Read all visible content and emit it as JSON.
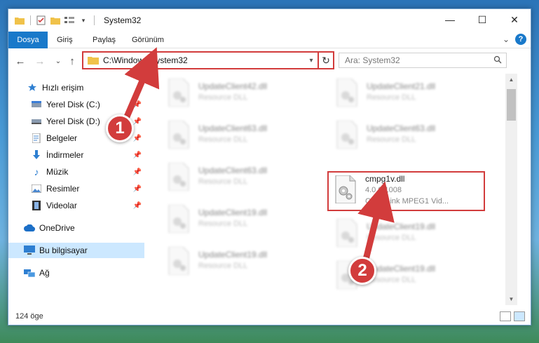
{
  "window": {
    "title": "System32",
    "controls": {
      "minimize": "—",
      "maximize": "☐",
      "close": "✕"
    }
  },
  "ribbon": {
    "tabs": [
      "Dosya",
      "Giriş",
      "Paylaş",
      "Görünüm"
    ],
    "expand": "⌄",
    "help": "?"
  },
  "nav": {
    "back": "←",
    "forward": "→",
    "recent": "⌄",
    "up": "↑",
    "address": "C:\\Windows\\System32",
    "search_placeholder": "Ara: System32"
  },
  "sidebar": {
    "items": [
      {
        "label": "Hızlı erişim",
        "icon": "star-icon",
        "pinned": false
      },
      {
        "label": "Yerel Disk (C:)",
        "icon": "drive-icon",
        "pinned": true
      },
      {
        "label": "Yerel Disk (D:)",
        "icon": "drive-icon",
        "pinned": true
      },
      {
        "label": "Belgeler",
        "icon": "documents-icon",
        "pinned": true
      },
      {
        "label": "İndirmeler",
        "icon": "download-icon",
        "pinned": true
      },
      {
        "label": "Müzik",
        "icon": "music-icon",
        "pinned": true
      },
      {
        "label": "Resimler",
        "icon": "pictures-icon",
        "pinned": true
      },
      {
        "label": "Videolar",
        "icon": "video-icon",
        "pinned": true
      },
      {
        "label": "OneDrive",
        "icon": "cloud-icon",
        "pinned": false
      },
      {
        "label": "Bu bilgisayar",
        "icon": "computer-icon",
        "pinned": false
      },
      {
        "label": "Ağ",
        "icon": "network-icon",
        "pinned": false
      }
    ]
  },
  "files": [
    {
      "name": "UpdateClient42.dll",
      "sub": "Resource DLL",
      "blurred": true
    },
    {
      "name": "UpdateClient21.dll",
      "sub": "Resource DLL",
      "blurred": true
    },
    {
      "name": "UpdateClient63.dll",
      "sub": "Resource DLL",
      "blurred": true
    },
    {
      "name": "UpdateClient63.dll",
      "sub": "Resource DLL",
      "blurred": true
    },
    {
      "name": "UpdateClient63.dll",
      "sub": "Resource DLL",
      "blurred": true
    },
    {
      "name": "cmpg1v.dll",
      "version": "4.0.0.1008",
      "sub": "CyberLink MPEG1 Vid...",
      "blurred": false
    },
    {
      "name": "UpdateClient19.dll",
      "sub": "Resource DLL",
      "blurred": true
    },
    {
      "name": "UpdateClient19.dll",
      "sub": "Resource DLL",
      "blurred": true
    },
    {
      "name": "UpdateClient19.dll",
      "sub": "Resource DLL",
      "blurred": true
    },
    {
      "name": "UpdateClient19.dll",
      "sub": "Resource DLL",
      "blurred": true
    }
  ],
  "status": {
    "count": "124 öge"
  },
  "annotations": {
    "badge1": "1",
    "badge2": "2"
  },
  "colors": {
    "accent": "#1979ca",
    "highlight": "#d23c3c",
    "selected": "#cce8ff"
  }
}
